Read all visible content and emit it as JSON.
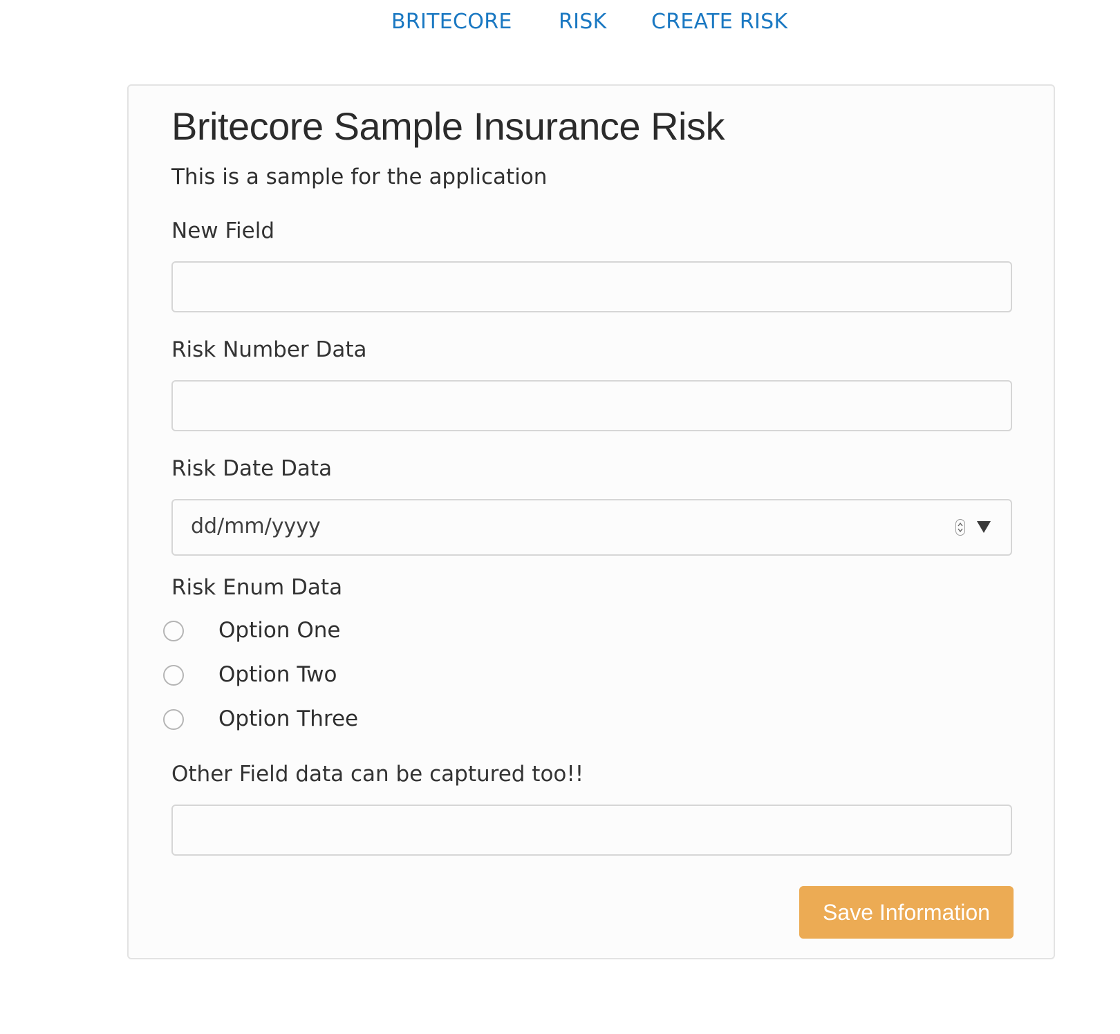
{
  "nav": {
    "items": [
      {
        "label": "BRITECORE"
      },
      {
        "label": "RISK"
      },
      {
        "label": "CREATE RISK"
      }
    ]
  },
  "form": {
    "title": "Britecore Sample Insurance Risk",
    "description": "This is a sample for the application",
    "fields": {
      "new_field": {
        "label": "New Field",
        "value": ""
      },
      "risk_number": {
        "label": "Risk Number Data",
        "value": ""
      },
      "risk_date": {
        "label": "Risk Date Data",
        "placeholder": "dd/mm/yyyy"
      },
      "risk_enum": {
        "label": "Risk Enum Data",
        "options": [
          {
            "label": "Option One",
            "selected": false
          },
          {
            "label": "Option Two",
            "selected": false
          },
          {
            "label": "Option Three",
            "selected": false
          }
        ]
      },
      "other_field": {
        "label": "Other Field data can be captured too!!",
        "value": ""
      }
    },
    "save_label": "Save Information"
  },
  "colors": {
    "link": "#1a78c2",
    "button": "#ecab54",
    "panel_border": "#e3e3e3"
  },
  "icons": {
    "date_spinner": "spinner-icon",
    "date_dropdown": "triangle-down-icon",
    "radio": "radio-circle-icon"
  }
}
